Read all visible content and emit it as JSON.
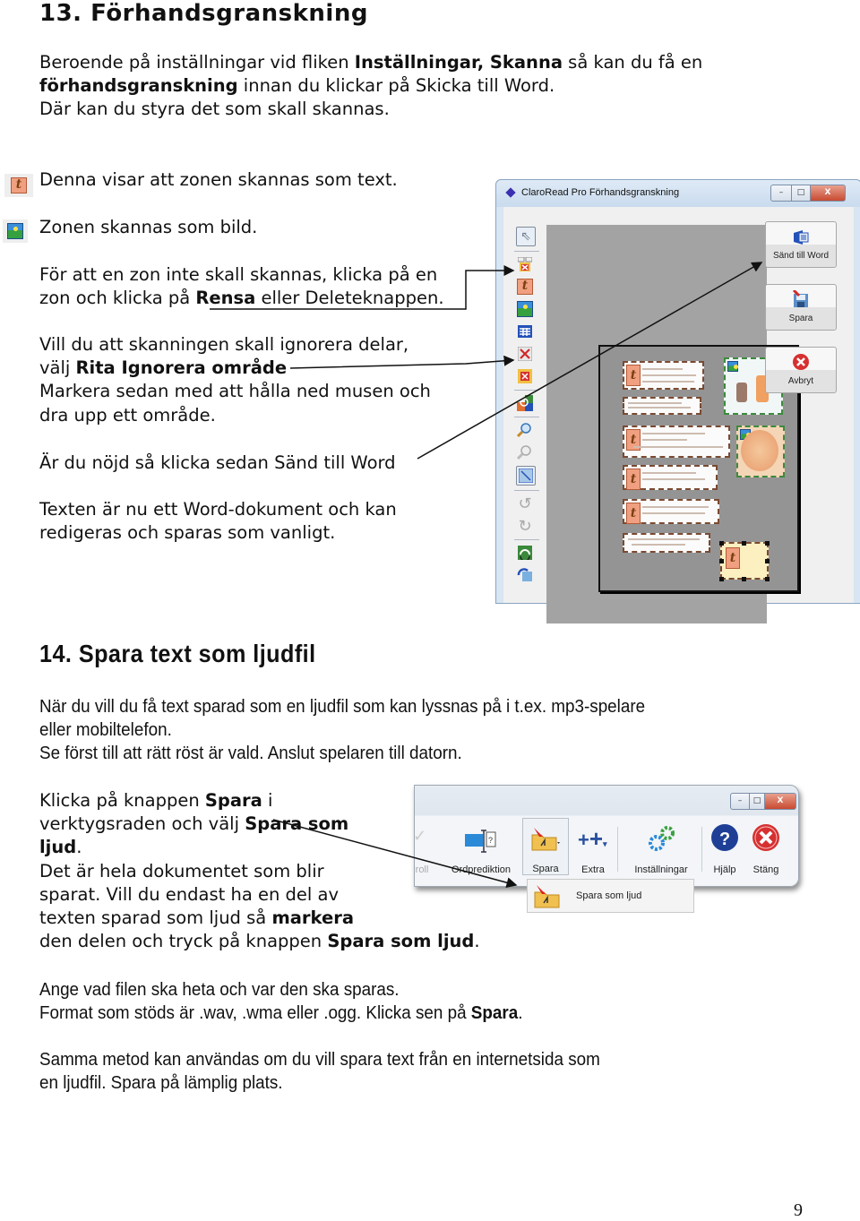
{
  "section13": {
    "heading": "13. Förhandsgranskning",
    "intro": {
      "l1_a": "Beroende på inställningar vid fliken ",
      "l1_b": "Inställningar, Skanna",
      "l1_c": " så kan du få en",
      "l2_a": "förhandsgranskning",
      "l2_b": " innan du klickar på Skicka till Word.",
      "l3": "Där kan du styra det som skall skannas."
    },
    "legend_text": {
      "icon": "text-zone-icon",
      "label": "Denna visar att zonen skannas som text."
    },
    "legend_image": {
      "icon": "image-zone-icon",
      "label": "Zonen skannas som bild."
    },
    "clear_zone": {
      "l1": "För att en zon inte skall skannas, klicka på en",
      "l2_a": "zon och klicka på ",
      "l2_b": "Rensa",
      "l2_c": " eller Deleteknappen."
    },
    "ignore_area": {
      "l1": "Vill du att skanningen skall ignorera delar,",
      "l2_a": "välj ",
      "l2_b": "Rita Ignorera område",
      "l3": "Markera sedan med att hålla ned musen och",
      "l4": "dra upp ett område."
    },
    "send_word": "Är du nöjd så klicka sedan Sänd till Word",
    "result": {
      "l1": "Texten är nu ett Word-dokument och kan",
      "l2": "redigeras och sparas som vanligt."
    }
  },
  "preview_window": {
    "title": "ClaroRead Pro Förhandsgranskning",
    "controls": {
      "minimize": "–",
      "maximize": "□",
      "close": "X"
    },
    "tools": [
      {
        "name": "select-pointer",
        "glyph": "⇖"
      },
      {
        "name": "clear-zones",
        "glyph": "✖"
      },
      {
        "name": "text-zone",
        "glyph": "t"
      },
      {
        "name": "image-zone",
        "glyph": "▣"
      },
      {
        "name": "table-zone",
        "glyph": "▦"
      },
      {
        "name": "ignore-area",
        "glyph": "✕"
      },
      {
        "name": "delete-zone",
        "glyph": "✖"
      },
      {
        "name": "swap-zones",
        "glyph": "⇄"
      },
      {
        "name": "zoom-in",
        "glyph": "🔍"
      },
      {
        "name": "zoom-out",
        "glyph": "🔍"
      },
      {
        "name": "fit-page",
        "glyph": "⤡"
      },
      {
        "name": "rotate-left",
        "glyph": "↺"
      },
      {
        "name": "rotate-right",
        "glyph": "↻"
      },
      {
        "name": "rescan",
        "glyph": "⟲"
      },
      {
        "name": "refresh",
        "glyph": "⟳"
      }
    ],
    "buttons": {
      "send_to_word": "Sänd till Word",
      "save": "Spara",
      "cancel": "Avbryt"
    }
  },
  "section14": {
    "heading": "14. Spara text som ljudfil",
    "intro": {
      "l1": "När du vill du få text sparad som en ljudfil som kan lyssnas på i t.ex. mp3-spelare",
      "l2": "eller mobiltelefon.",
      "l3": "Se först till att rätt röst är vald. Anslut spelaren till datorn."
    },
    "instructions": {
      "l1_a": "Klicka på knappen ",
      "l1_b": "Spara",
      "l1_c": " i",
      "l2_a": "verktygsraden och välj ",
      "l2_b": "Spara som",
      "l3_a": "ljud",
      "l3_b": ".",
      "l4": "Det är hela dokumentet som blir",
      "l5": "sparat. Vill du endast ha en del av",
      "l6_a": "texten sparad som ljud så ",
      "l6_b": "markera",
      "l7_a": "den delen och tryck på knappen ",
      "l7_b": "Spara som ljud",
      "l7_c": "."
    },
    "file_info": {
      "l1": "Ange vad filen ska heta och var den ska sparas.",
      "l2_a": "Format som stöds är .wav, .wma eller .ogg. Klicka sen på ",
      "l2_b": "Spara",
      "l2_c": "."
    },
    "internet": {
      "l1": "Samma metod kan användas om du vill spara text från en internetsida som",
      "l2": "en ljudfil. Spara på lämplig plats."
    }
  },
  "toolbar": {
    "items": [
      {
        "label": "roll",
        "icon": "partial-icon"
      },
      {
        "label": "Ordprediktion",
        "icon": "word-prediction-icon"
      },
      {
        "label": "Spara",
        "icon": "save-audio-icon"
      },
      {
        "label": "Extra",
        "icon": "extra-icon"
      },
      {
        "label": "Inställningar",
        "icon": "settings-icon"
      },
      {
        "label": "Hjälp",
        "icon": "help-icon"
      },
      {
        "label": "Stäng",
        "icon": "close-icon"
      }
    ],
    "dropdown_item": "Spara som ljud",
    "controls": {
      "minimize": "–",
      "maximize": "□",
      "close": "X"
    }
  },
  "page_number": "9"
}
